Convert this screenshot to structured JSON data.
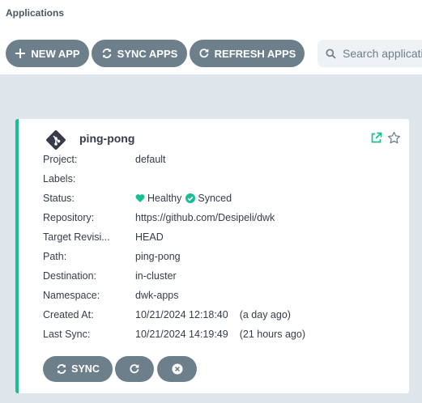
{
  "header": {
    "title": "Applications"
  },
  "toolbar": {
    "new_app_label": "NEW APP",
    "sync_apps_label": "SYNC APPS",
    "refresh_apps_label": "REFRESH APPS",
    "search_placeholder": "Search applications..."
  },
  "colors": {
    "accent_healthy": "#18be94",
    "button_bg": "#6d7f8b",
    "background": "#dee6eb"
  },
  "app": {
    "name": "ping-pong",
    "icon": "git-icon",
    "fields": {
      "project": {
        "label": "Project:",
        "value": "default"
      },
      "labels": {
        "label": "Labels:",
        "value": ""
      },
      "status": {
        "label": "Status:",
        "health": "Healthy",
        "sync": "Synced"
      },
      "repository": {
        "label": "Repository:",
        "value": "https://github.com/Desipeli/dwk"
      },
      "target_revision": {
        "label": "Target Revisi...",
        "value": "HEAD"
      },
      "path": {
        "label": "Path:",
        "value": "ping-pong"
      },
      "destination": {
        "label": "Destination:",
        "value": "in-cluster"
      },
      "namespace": {
        "label": "Namespace:",
        "value": "dwk-apps"
      },
      "created_at": {
        "label": "Created At:",
        "value": "10/21/2024 12:18:40",
        "relative": "(a day ago)"
      },
      "last_sync": {
        "label": "Last Sync:",
        "value": "10/21/2024 14:19:49",
        "relative": "(21 hours ago)"
      }
    },
    "actions": {
      "sync_label": "SYNC"
    }
  }
}
